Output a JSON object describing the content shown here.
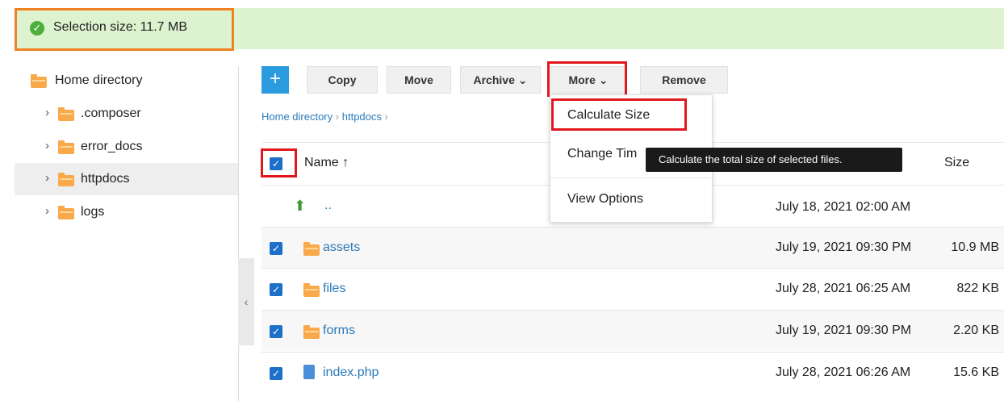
{
  "status": {
    "text": "Selection size: 11.7 MB"
  },
  "sidebar": {
    "items": [
      {
        "label": "Home directory"
      },
      {
        "label": ".composer"
      },
      {
        "label": "error_docs"
      },
      {
        "label": "httpdocs"
      },
      {
        "label": "logs"
      }
    ]
  },
  "toolbar": {
    "add_label": "+",
    "copy_label": "Copy",
    "move_label": "Move",
    "archive_label": "Archive ⌄",
    "more_label": "More ⌄",
    "remove_label": "Remove"
  },
  "breadcrumb": {
    "home": "Home directory",
    "current": "httpdocs",
    "sep": "›"
  },
  "more_menu": {
    "items": [
      "Calculate Size",
      "Change Tim",
      "View Options"
    ]
  },
  "tooltip": {
    "text": "Calculate the total size of selected files."
  },
  "table": {
    "col_name": "Name ↑",
    "col_size": "Size",
    "rows": [
      {
        "name": "..",
        "date": "July 18, 2021 02:00 AM",
        "size": "",
        "checked": false
      },
      {
        "name": "assets",
        "date": "July 19, 2021 09:30 PM",
        "size": "10.9 MB",
        "checked": true
      },
      {
        "name": "files",
        "date": "July 28, 2021 06:25 AM",
        "size": "822 KB",
        "checked": true
      },
      {
        "name": "forms",
        "date": "July 19, 2021 09:30 PM",
        "size": "2.20 KB",
        "checked": true
      },
      {
        "name": "index.php",
        "date": "July 28, 2021 06:26 AM",
        "size": "15.6 KB",
        "checked": true
      }
    ]
  },
  "colors": {
    "highlight_red": "#e1171e",
    "highlight_orange": "#f08122",
    "status_bg": "#ddf2cf",
    "accent_blue": "#2b9be0"
  }
}
